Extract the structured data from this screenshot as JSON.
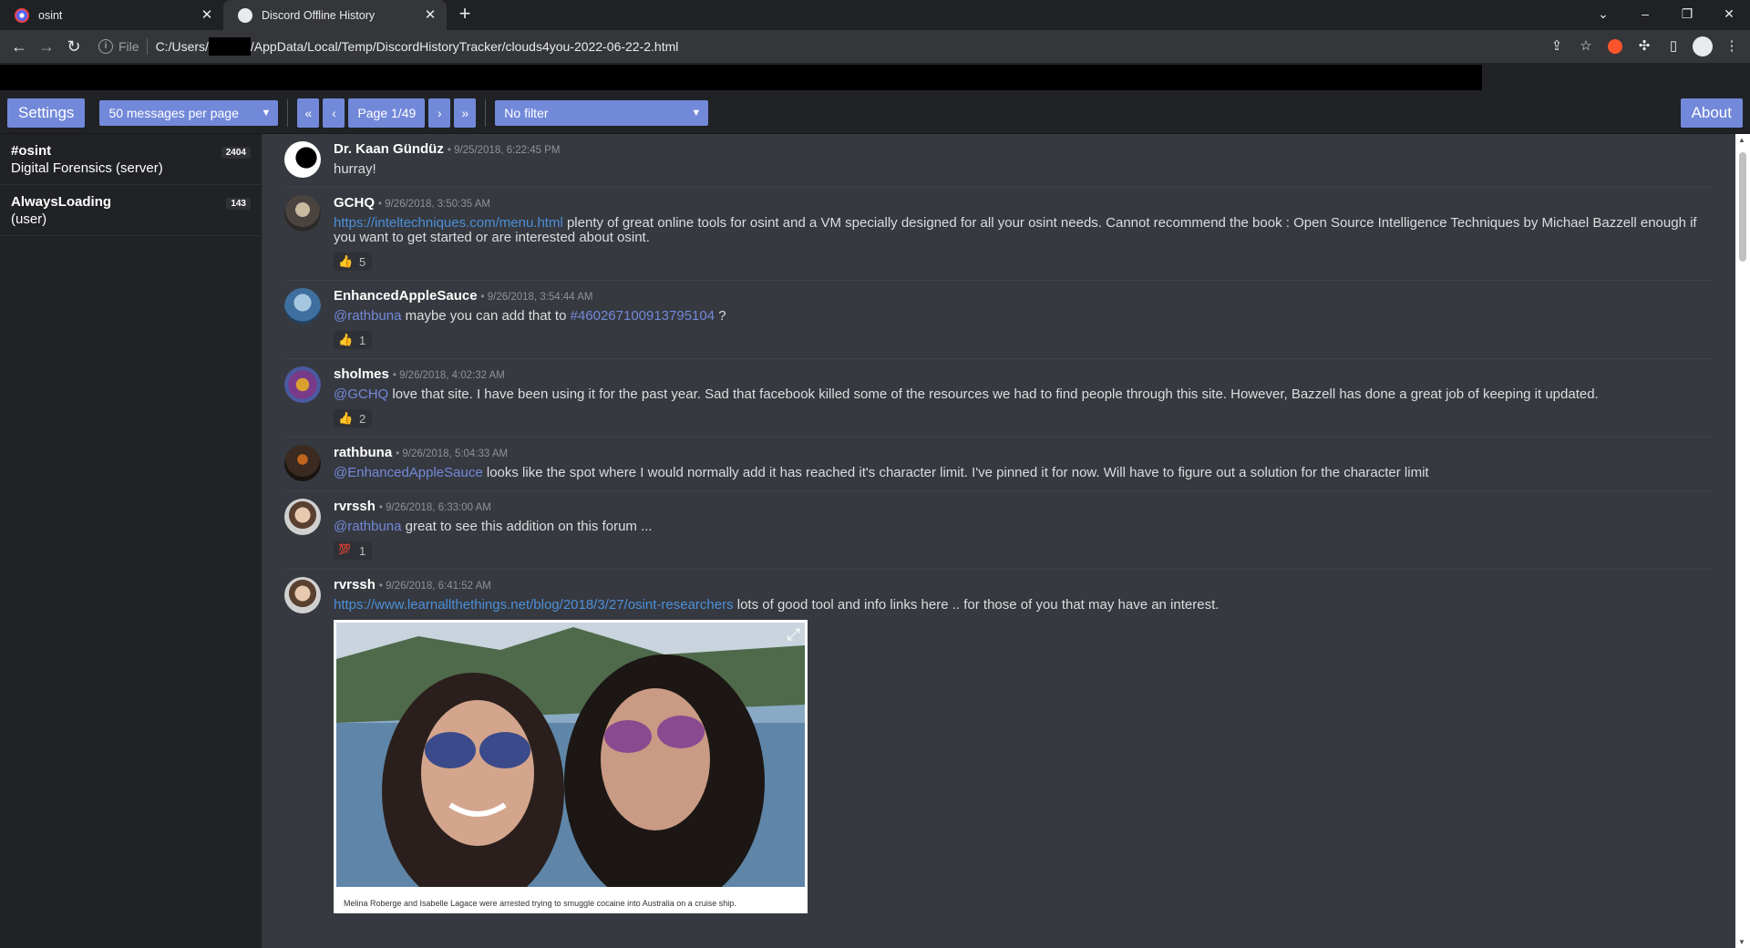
{
  "browser": {
    "tabs": [
      {
        "title": "osint",
        "active": false
      },
      {
        "title": "Discord Offline History",
        "active": true
      }
    ],
    "address": {
      "scheme": "File",
      "url_prefix": "C:/Users/",
      "url_suffix": "/AppData/Local/Temp/DiscordHistoryTracker/clouds4you-2022-06-22-2.html"
    }
  },
  "nav": {
    "settings_label": "Settings",
    "per_page": "50 messages per page",
    "first": "«",
    "prev": "‹",
    "page_label": "Page 1/49",
    "next": "›",
    "last": "»",
    "filter": "No filter",
    "about_label": "About"
  },
  "sidebar": {
    "channels": [
      {
        "name": "#osint",
        "sub": "Digital Forensics (server)",
        "count": "2404"
      },
      {
        "name": "AlwaysLoading",
        "sub": "(user)",
        "count": "143"
      }
    ]
  },
  "messages": [
    {
      "author": "Dr. Kaan Gündüz",
      "time": "• 9/25/2018, 6:22:45 PM",
      "text": "hurray!"
    },
    {
      "author": "GCHQ",
      "time": "• 9/26/2018, 3:50:35 AM",
      "link": "https://inteltechniques.com/menu.html",
      "text": " plenty of great online tools for osint and a VM specially designed for all your osint needs. Cannot recommend the book : Open Source Intelligence Techniques by Michael Bazzell enough if you want to get started or are interested about osint.",
      "reaction": "5"
    },
    {
      "author": "EnhancedAppleSauce",
      "time": "• 9/26/2018, 3:54:44 AM",
      "mention": "@rathbuna",
      "text": " maybe you can add that to ",
      "mention2": "#460267100913795104",
      "text2": " ?",
      "reaction": "1"
    },
    {
      "author": "sholmes",
      "time": "• 9/26/2018, 4:02:32 AM",
      "mention": "@GCHQ",
      "text": " love that site. I have been using it for the past year. Sad that facebook killed some of the resources we had to find people through this site. However, Bazzell has done a great job of keeping it updated.",
      "reaction": "2"
    },
    {
      "author": "rathbuna",
      "time": "• 9/26/2018, 5:04:33 AM",
      "mention": "@EnhancedAppleSauce",
      "text": " looks like the spot where I would normally add it has reached it's character limit. I've pinned it for now. Will have to figure out a solution for the character limit"
    },
    {
      "author": "rvrssh",
      "time": "• 9/26/2018, 6:33:00 AM",
      "mention": "@rathbuna",
      "text": " great to see this addition on this forum ...",
      "reaction": "1"
    },
    {
      "author": "rvrssh",
      "time": "• 9/26/2018, 6:41:52 AM",
      "link": "https://www.learnallthethings.net/blog/2018/3/27/osint-researchers",
      "text": " lots of good tool and info links here .. for those of you that may have an interest.",
      "embed_caption": "Melina Roberge and Isabelle Lagace were arrested trying to smuggle cocaine into Australia on a cruise ship."
    }
  ]
}
